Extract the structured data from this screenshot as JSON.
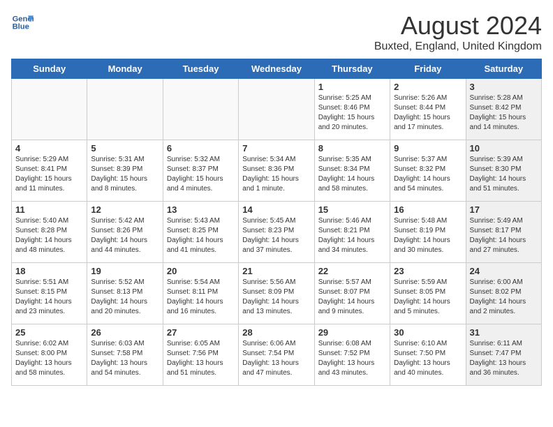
{
  "header": {
    "logo_line1": "General",
    "logo_line2": "Blue",
    "title": "August 2024",
    "subtitle": "Buxted, England, United Kingdom"
  },
  "days_of_week": [
    "Sunday",
    "Monday",
    "Tuesday",
    "Wednesday",
    "Thursday",
    "Friday",
    "Saturday"
  ],
  "weeks": [
    [
      {
        "day": "",
        "info": "",
        "shaded": false,
        "empty": true
      },
      {
        "day": "",
        "info": "",
        "shaded": false,
        "empty": true
      },
      {
        "day": "",
        "info": "",
        "shaded": false,
        "empty": true
      },
      {
        "day": "",
        "info": "",
        "shaded": false,
        "empty": true
      },
      {
        "day": "1",
        "info": "Sunrise: 5:25 AM\nSunset: 8:46 PM\nDaylight: 15 hours and 20 minutes.",
        "shaded": false,
        "empty": false
      },
      {
        "day": "2",
        "info": "Sunrise: 5:26 AM\nSunset: 8:44 PM\nDaylight: 15 hours and 17 minutes.",
        "shaded": false,
        "empty": false
      },
      {
        "day": "3",
        "info": "Sunrise: 5:28 AM\nSunset: 8:42 PM\nDaylight: 15 hours and 14 minutes.",
        "shaded": true,
        "empty": false
      }
    ],
    [
      {
        "day": "4",
        "info": "Sunrise: 5:29 AM\nSunset: 8:41 PM\nDaylight: 15 hours and 11 minutes.",
        "shaded": false,
        "empty": false
      },
      {
        "day": "5",
        "info": "Sunrise: 5:31 AM\nSunset: 8:39 PM\nDaylight: 15 hours and 8 minutes.",
        "shaded": false,
        "empty": false
      },
      {
        "day": "6",
        "info": "Sunrise: 5:32 AM\nSunset: 8:37 PM\nDaylight: 15 hours and 4 minutes.",
        "shaded": false,
        "empty": false
      },
      {
        "day": "7",
        "info": "Sunrise: 5:34 AM\nSunset: 8:36 PM\nDaylight: 15 hours and 1 minute.",
        "shaded": false,
        "empty": false
      },
      {
        "day": "8",
        "info": "Sunrise: 5:35 AM\nSunset: 8:34 PM\nDaylight: 14 hours and 58 minutes.",
        "shaded": false,
        "empty": false
      },
      {
        "day": "9",
        "info": "Sunrise: 5:37 AM\nSunset: 8:32 PM\nDaylight: 14 hours and 54 minutes.",
        "shaded": false,
        "empty": false
      },
      {
        "day": "10",
        "info": "Sunrise: 5:39 AM\nSunset: 8:30 PM\nDaylight: 14 hours and 51 minutes.",
        "shaded": true,
        "empty": false
      }
    ],
    [
      {
        "day": "11",
        "info": "Sunrise: 5:40 AM\nSunset: 8:28 PM\nDaylight: 14 hours and 48 minutes.",
        "shaded": false,
        "empty": false
      },
      {
        "day": "12",
        "info": "Sunrise: 5:42 AM\nSunset: 8:26 PM\nDaylight: 14 hours and 44 minutes.",
        "shaded": false,
        "empty": false
      },
      {
        "day": "13",
        "info": "Sunrise: 5:43 AM\nSunset: 8:25 PM\nDaylight: 14 hours and 41 minutes.",
        "shaded": false,
        "empty": false
      },
      {
        "day": "14",
        "info": "Sunrise: 5:45 AM\nSunset: 8:23 PM\nDaylight: 14 hours and 37 minutes.",
        "shaded": false,
        "empty": false
      },
      {
        "day": "15",
        "info": "Sunrise: 5:46 AM\nSunset: 8:21 PM\nDaylight: 14 hours and 34 minutes.",
        "shaded": false,
        "empty": false
      },
      {
        "day": "16",
        "info": "Sunrise: 5:48 AM\nSunset: 8:19 PM\nDaylight: 14 hours and 30 minutes.",
        "shaded": false,
        "empty": false
      },
      {
        "day": "17",
        "info": "Sunrise: 5:49 AM\nSunset: 8:17 PM\nDaylight: 14 hours and 27 minutes.",
        "shaded": true,
        "empty": false
      }
    ],
    [
      {
        "day": "18",
        "info": "Sunrise: 5:51 AM\nSunset: 8:15 PM\nDaylight: 14 hours and 23 minutes.",
        "shaded": false,
        "empty": false
      },
      {
        "day": "19",
        "info": "Sunrise: 5:52 AM\nSunset: 8:13 PM\nDaylight: 14 hours and 20 minutes.",
        "shaded": false,
        "empty": false
      },
      {
        "day": "20",
        "info": "Sunrise: 5:54 AM\nSunset: 8:11 PM\nDaylight: 14 hours and 16 minutes.",
        "shaded": false,
        "empty": false
      },
      {
        "day": "21",
        "info": "Sunrise: 5:56 AM\nSunset: 8:09 PM\nDaylight: 14 hours and 13 minutes.",
        "shaded": false,
        "empty": false
      },
      {
        "day": "22",
        "info": "Sunrise: 5:57 AM\nSunset: 8:07 PM\nDaylight: 14 hours and 9 minutes.",
        "shaded": false,
        "empty": false
      },
      {
        "day": "23",
        "info": "Sunrise: 5:59 AM\nSunset: 8:05 PM\nDaylight: 14 hours and 5 minutes.",
        "shaded": false,
        "empty": false
      },
      {
        "day": "24",
        "info": "Sunrise: 6:00 AM\nSunset: 8:02 PM\nDaylight: 14 hours and 2 minutes.",
        "shaded": true,
        "empty": false
      }
    ],
    [
      {
        "day": "25",
        "info": "Sunrise: 6:02 AM\nSunset: 8:00 PM\nDaylight: 13 hours and 58 minutes.",
        "shaded": false,
        "empty": false
      },
      {
        "day": "26",
        "info": "Sunrise: 6:03 AM\nSunset: 7:58 PM\nDaylight: 13 hours and 54 minutes.",
        "shaded": false,
        "empty": false
      },
      {
        "day": "27",
        "info": "Sunrise: 6:05 AM\nSunset: 7:56 PM\nDaylight: 13 hours and 51 minutes.",
        "shaded": false,
        "empty": false
      },
      {
        "day": "28",
        "info": "Sunrise: 6:06 AM\nSunset: 7:54 PM\nDaylight: 13 hours and 47 minutes.",
        "shaded": false,
        "empty": false
      },
      {
        "day": "29",
        "info": "Sunrise: 6:08 AM\nSunset: 7:52 PM\nDaylight: 13 hours and 43 minutes.",
        "shaded": false,
        "empty": false
      },
      {
        "day": "30",
        "info": "Sunrise: 6:10 AM\nSunset: 7:50 PM\nDaylight: 13 hours and 40 minutes.",
        "shaded": false,
        "empty": false
      },
      {
        "day": "31",
        "info": "Sunrise: 6:11 AM\nSunset: 7:47 PM\nDaylight: 13 hours and 36 minutes.",
        "shaded": true,
        "empty": false
      }
    ]
  ]
}
